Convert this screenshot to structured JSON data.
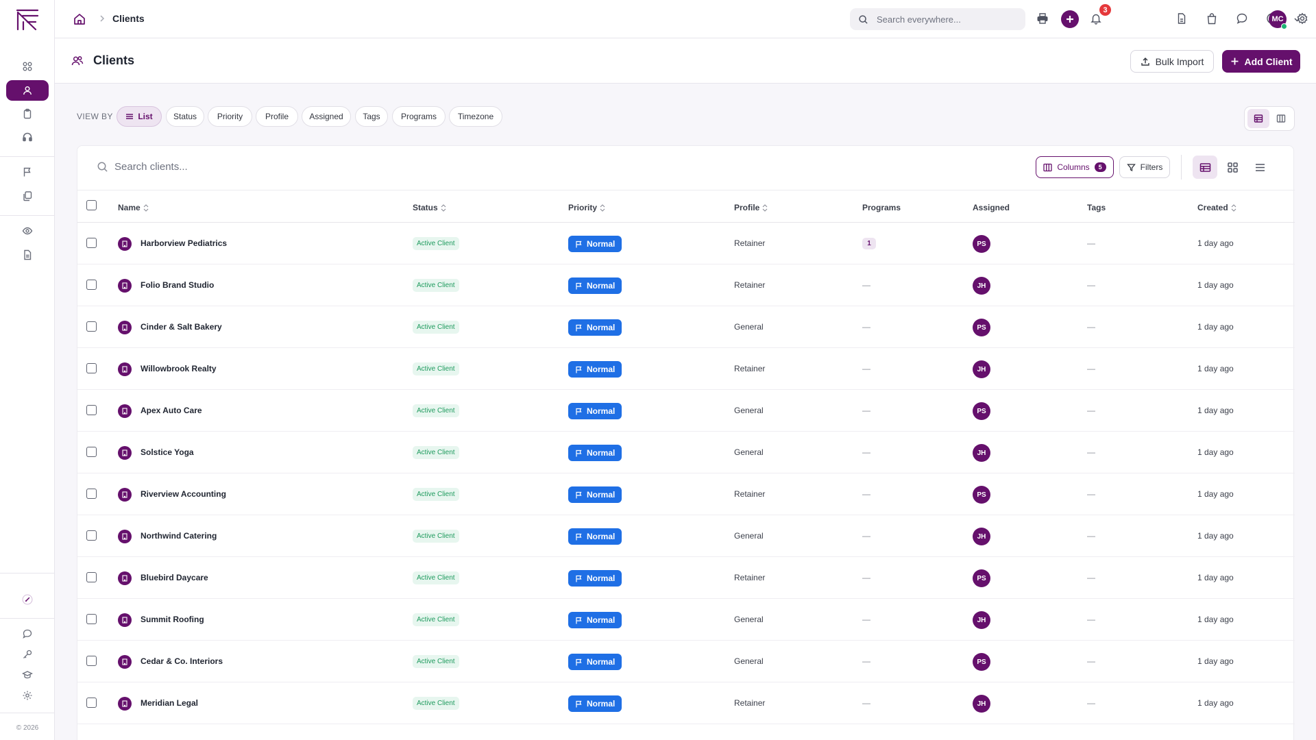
{
  "app": {
    "copyright": "© 2026"
  },
  "breadcrumb": {
    "current": "Clients"
  },
  "topbar": {
    "search_placeholder": "Search everywhere...",
    "notification_count": "3",
    "user_initials": "MC"
  },
  "sidebar": {
    "items": [
      {
        "name": "dashboard",
        "icon": "grid-icon",
        "active": false
      },
      {
        "name": "clients",
        "icon": "users-icon",
        "active": true
      },
      {
        "name": "tasks",
        "icon": "clipboard-icon",
        "active": false
      },
      {
        "name": "support",
        "icon": "headset-icon",
        "active": false
      },
      {
        "name": "flags",
        "icon": "flag-icon",
        "active": false
      },
      {
        "name": "templates",
        "icon": "copy-icon",
        "active": false
      },
      {
        "name": "monitoring",
        "icon": "eye-icon",
        "active": false
      },
      {
        "name": "reports",
        "icon": "document-icon",
        "active": false
      }
    ]
  },
  "page": {
    "title": "Clients",
    "bulk_import_label": "Bulk Import",
    "add_client_label": "Add Client"
  },
  "view_by": {
    "label": "VIEW BY",
    "options": [
      "List",
      "Status",
      "Priority",
      "Profile",
      "Assigned",
      "Tags",
      "Programs",
      "Timezone"
    ],
    "selected": "List"
  },
  "toolbar": {
    "search_placeholder": "Search clients...",
    "columns_label": "Columns",
    "columns_count": "5",
    "filters_label": "Filters"
  },
  "table": {
    "columns": [
      "Name",
      "Status",
      "Priority",
      "Profile",
      "Programs",
      "Assigned",
      "Tags",
      "Created"
    ],
    "rows": [
      {
        "name": "Harborview Pediatrics",
        "status": "Active Client",
        "priority": "Normal",
        "profile": "Retainer",
        "programs": "1",
        "assigned": "PS",
        "tags": "—",
        "created": "1 day ago"
      },
      {
        "name": "Folio Brand Studio",
        "status": "Active Client",
        "priority": "Normal",
        "profile": "Retainer",
        "programs": "—",
        "assigned": "JH",
        "tags": "—",
        "created": "1 day ago"
      },
      {
        "name": "Cinder & Salt Bakery",
        "status": "Active Client",
        "priority": "Normal",
        "profile": "General",
        "programs": "—",
        "assigned": "PS",
        "tags": "—",
        "created": "1 day ago"
      },
      {
        "name": "Willowbrook Realty",
        "status": "Active Client",
        "priority": "Normal",
        "profile": "Retainer",
        "programs": "—",
        "assigned": "JH",
        "tags": "—",
        "created": "1 day ago"
      },
      {
        "name": "Apex Auto Care",
        "status": "Active Client",
        "priority": "Normal",
        "profile": "General",
        "programs": "—",
        "assigned": "PS",
        "tags": "—",
        "created": "1 day ago"
      },
      {
        "name": "Solstice Yoga",
        "status": "Active Client",
        "priority": "Normal",
        "profile": "General",
        "programs": "—",
        "assigned": "JH",
        "tags": "—",
        "created": "1 day ago"
      },
      {
        "name": "Riverview Accounting",
        "status": "Active Client",
        "priority": "Normal",
        "profile": "Retainer",
        "programs": "—",
        "assigned": "PS",
        "tags": "—",
        "created": "1 day ago"
      },
      {
        "name": "Northwind Catering",
        "status": "Active Client",
        "priority": "Normal",
        "profile": "General",
        "programs": "—",
        "assigned": "JH",
        "tags": "—",
        "created": "1 day ago"
      },
      {
        "name": "Bluebird Daycare",
        "status": "Active Client",
        "priority": "Normal",
        "profile": "Retainer",
        "programs": "—",
        "assigned": "PS",
        "tags": "—",
        "created": "1 day ago"
      },
      {
        "name": "Summit Roofing",
        "status": "Active Client",
        "priority": "Normal",
        "profile": "General",
        "programs": "—",
        "assigned": "JH",
        "tags": "—",
        "created": "1 day ago"
      },
      {
        "name": "Cedar & Co. Interiors",
        "status": "Active Client",
        "priority": "Normal",
        "profile": "General",
        "programs": "—",
        "assigned": "PS",
        "tags": "—",
        "created": "1 day ago"
      },
      {
        "name": "Meridian Legal",
        "status": "Active Client",
        "priority": "Normal",
        "profile": "Retainer",
        "programs": "—",
        "assigned": "JH",
        "tags": "—",
        "created": "1 day ago"
      }
    ]
  },
  "colors": {
    "brand": "#65106c",
    "priority_normal": "#1f6fe5",
    "status_active_bg": "#e7f6ef",
    "status_active_text": "#1e9a5d",
    "notification": "#e5383b"
  }
}
